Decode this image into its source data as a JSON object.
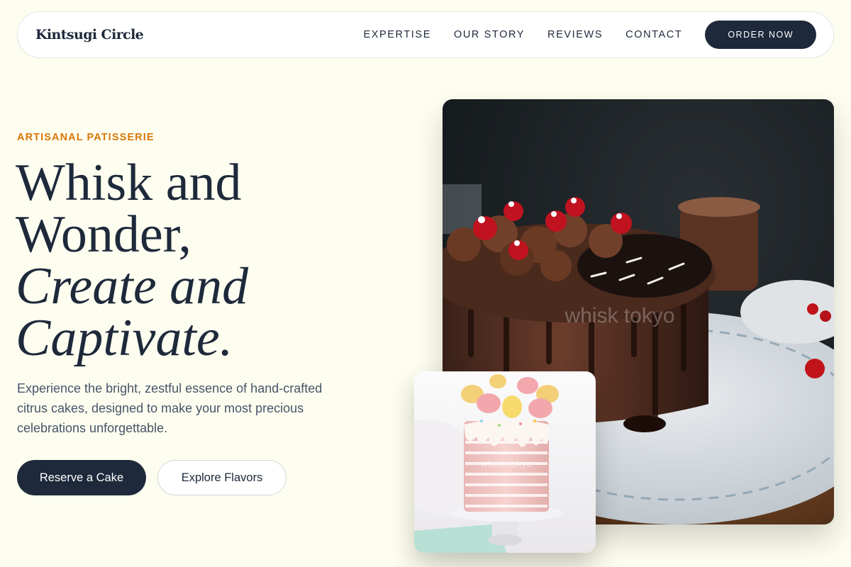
{
  "nav": {
    "brand": "Kintsugi Circle",
    "links": [
      "EXPERTISE",
      "OUR STORY",
      "REVIEWS",
      "CONTACT"
    ],
    "cta": "ORDER NOW"
  },
  "hero": {
    "eyebrow": "ARTISANAL PATISSERIE",
    "headline_line1": "Whisk and",
    "headline_line2": "Wonder,",
    "headline_line3": "Create and",
    "headline_line4": "Captivate.",
    "lead": "Experience the bright, zestful essence of hand-crafted citrus cakes, designed to make your most precious celebrations unforgettable.",
    "primary_button": "Reserve a Cake",
    "secondary_button": "Explore Flavors"
  },
  "images": {
    "main_watermark": "whisk tokyo",
    "small_watermark": "whisk tokyo"
  },
  "colors": {
    "background": "#fefef0",
    "navy": "#1e293b",
    "accent": "#d97706",
    "muted_text": "#475569"
  }
}
